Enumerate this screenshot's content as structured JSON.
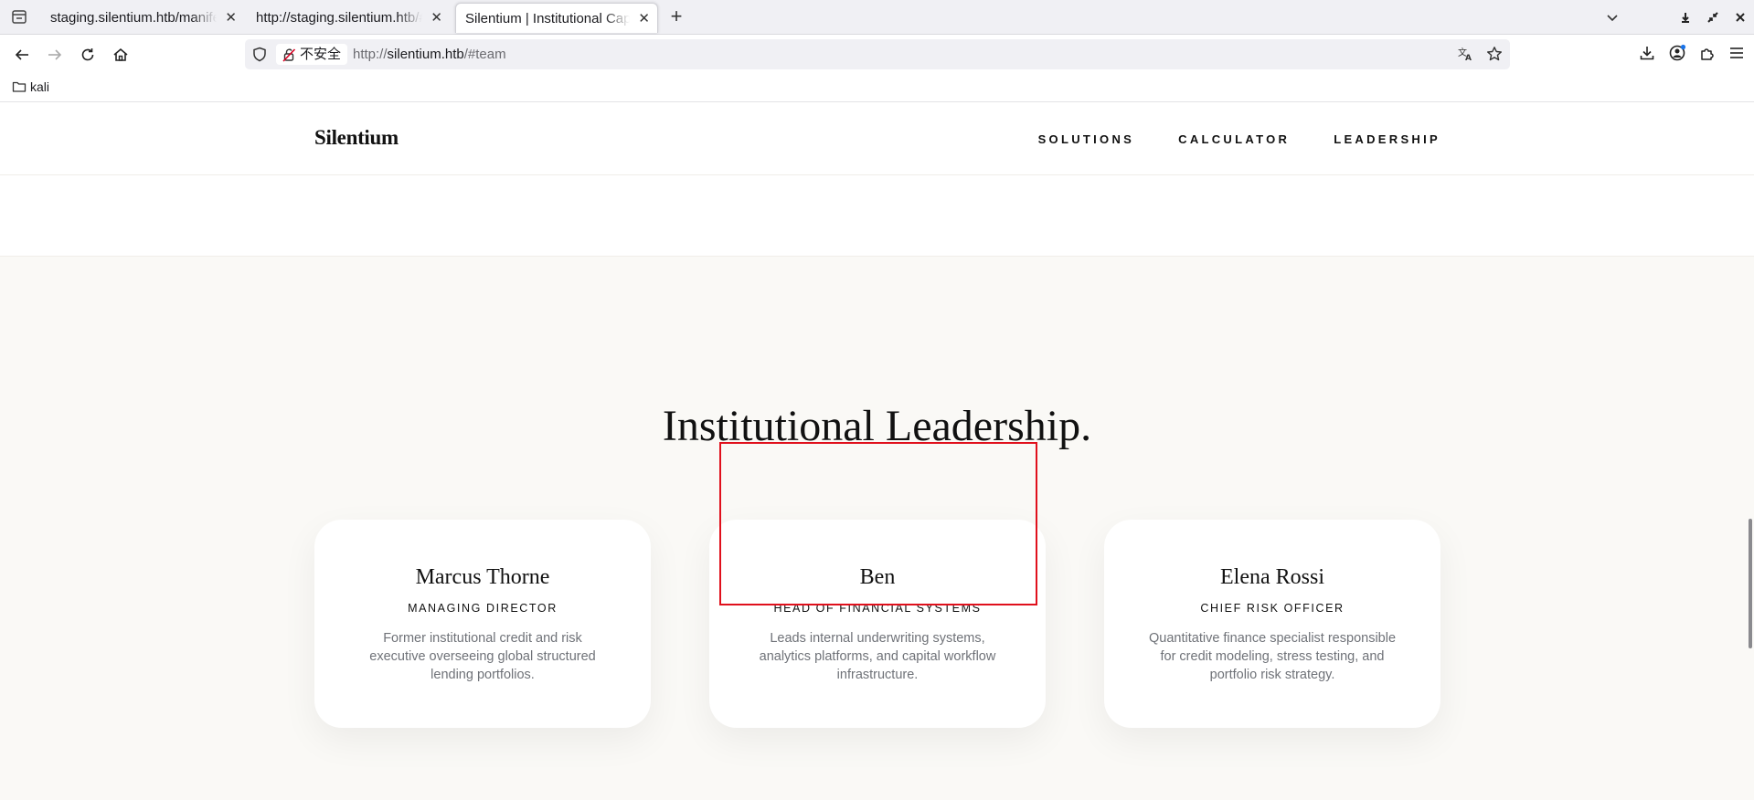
{
  "browser": {
    "tabs": [
      {
        "title": "staging.silentium.htb/manifest",
        "active": false
      },
      {
        "title": "http://staging.silentium.htb/#",
        "active": false
      },
      {
        "title": "Silentium | Institutional Capital",
        "active": true
      }
    ],
    "close_glyph": "✕",
    "new_tab_glyph": "+",
    "security_label": "不安全",
    "url_scheme": "http://",
    "url_host": "silentium.htb",
    "url_path": "/#team",
    "bookmark_folder": "kali"
  },
  "site": {
    "logo": "Silentium",
    "nav": [
      "SOLUTIONS",
      "CALCULATOR",
      "LEADERSHIP"
    ],
    "section_title": "Institutional Leadership.",
    "team": [
      {
        "name": "Marcus Thorne",
        "role": "MANAGING DIRECTOR",
        "desc": "Former institutional credit and risk executive overseeing global structured lending portfolios."
      },
      {
        "name": "Ben",
        "role": "HEAD OF FINANCIAL SYSTEMS",
        "desc": "Leads internal underwriting systems, analytics platforms, and capital workflow infrastructure."
      },
      {
        "name": "Elena Rossi",
        "role": "CHIEF RISK OFFICER",
        "desc": "Quantitative finance specialist responsible for credit modeling, stress testing, and portfolio risk strategy."
      }
    ]
  },
  "colors": {
    "highlight": "#e0101c",
    "section_bg": "#faf9f6",
    "chrome_bg": "#f0f0f4"
  }
}
